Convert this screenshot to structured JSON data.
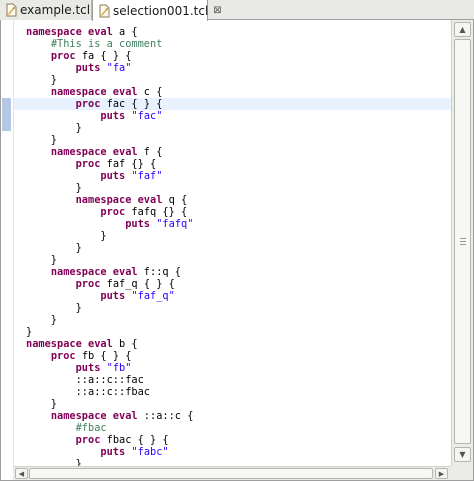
{
  "tabs": [
    {
      "label": "example.tcl",
      "active": false
    },
    {
      "label": "selection001.tcl",
      "active": true,
      "close": "⊠"
    }
  ],
  "colors": {
    "keyword": "#7f0055",
    "comment": "#3f7f5f",
    "string": "#2a00ff",
    "current_line": "#e8f2fe"
  },
  "icons": {
    "file": "tcl-file-icon",
    "close": "close-icon"
  },
  "editor": {
    "current_line": 6,
    "lines": [
      [
        [
          "kw",
          "namespace eval"
        ],
        [
          "t",
          " a {"
        ]
      ],
      [
        [
          "t",
          "    "
        ],
        [
          "cm",
          "#This is a comment"
        ]
      ],
      [
        [
          "t",
          "    "
        ],
        [
          "kw",
          "proc"
        ],
        [
          "t",
          " fa { } {"
        ]
      ],
      [
        [
          "t",
          "        "
        ],
        [
          "kw",
          "puts"
        ],
        [
          "t",
          " "
        ],
        [
          "st",
          "\"fa\""
        ]
      ],
      [
        [
          "t",
          "    }"
        ]
      ],
      [
        [
          "t",
          "    "
        ],
        [
          "kw",
          "namespace eval"
        ],
        [
          "t",
          " c {"
        ]
      ],
      [
        [
          "t",
          "        "
        ],
        [
          "kw",
          "proc"
        ],
        [
          "t",
          " fac { } {"
        ]
      ],
      [
        [
          "t",
          "            "
        ],
        [
          "kw",
          "puts"
        ],
        [
          "t",
          " "
        ],
        [
          "st",
          "\"fac\""
        ]
      ],
      [
        [
          "t",
          "        }"
        ]
      ],
      [
        [
          "t",
          "    }"
        ]
      ],
      [
        [
          "t",
          "    "
        ],
        [
          "kw",
          "namespace eval"
        ],
        [
          "t",
          " f {"
        ]
      ],
      [
        [
          "t",
          "        "
        ],
        [
          "kw",
          "proc"
        ],
        [
          "t",
          " faf {} {"
        ]
      ],
      [
        [
          "t",
          "            "
        ],
        [
          "kw",
          "puts"
        ],
        [
          "t",
          " "
        ],
        [
          "st",
          "\"faf\""
        ]
      ],
      [
        [
          "t",
          "        }"
        ]
      ],
      [
        [
          "t",
          "        "
        ],
        [
          "kw",
          "namespace eval"
        ],
        [
          "t",
          " q {"
        ]
      ],
      [
        [
          "t",
          "            "
        ],
        [
          "kw",
          "proc"
        ],
        [
          "t",
          " fafq {} {"
        ]
      ],
      [
        [
          "t",
          "                "
        ],
        [
          "kw",
          "puts"
        ],
        [
          "t",
          " "
        ],
        [
          "st",
          "\"fafq\""
        ]
      ],
      [
        [
          "t",
          "            }"
        ]
      ],
      [
        [
          "t",
          "        }"
        ]
      ],
      [
        [
          "t",
          "    }"
        ]
      ],
      [
        [
          "t",
          "    "
        ],
        [
          "kw",
          "namespace eval"
        ],
        [
          "t",
          " f::q {"
        ]
      ],
      [
        [
          "t",
          "        "
        ],
        [
          "kw",
          "proc"
        ],
        [
          "t",
          " faf_q { } {"
        ]
      ],
      [
        [
          "t",
          "            "
        ],
        [
          "kw",
          "puts"
        ],
        [
          "t",
          " "
        ],
        [
          "st",
          "\"faf_q\""
        ]
      ],
      [
        [
          "t",
          "        }"
        ]
      ],
      [
        [
          "t",
          "    }"
        ]
      ],
      [
        [
          "t",
          "}"
        ]
      ],
      [
        [
          "kw",
          "namespace eval"
        ],
        [
          "t",
          " b {"
        ]
      ],
      [
        [
          "t",
          "    "
        ],
        [
          "kw",
          "proc"
        ],
        [
          "t",
          " fb { } {"
        ]
      ],
      [
        [
          "t",
          "        "
        ],
        [
          "kw",
          "puts"
        ],
        [
          "t",
          " "
        ],
        [
          "st",
          "\"fb\""
        ]
      ],
      [
        [
          "t",
          "        ::a::c::fac"
        ]
      ],
      [
        [
          "t",
          "        ::a::c::fbac"
        ]
      ],
      [
        [
          "t",
          "    }"
        ]
      ],
      [
        [
          "t",
          "    "
        ],
        [
          "kw",
          "namespace eval"
        ],
        [
          "t",
          " ::a::c {"
        ]
      ],
      [
        [
          "t",
          "        "
        ],
        [
          "cm",
          "#fbac"
        ]
      ],
      [
        [
          "t",
          "        "
        ],
        [
          "kw",
          "proc"
        ],
        [
          "t",
          " fbac { } {"
        ]
      ],
      [
        [
          "t",
          "            "
        ],
        [
          "kw",
          "puts"
        ],
        [
          "t",
          " "
        ],
        [
          "st",
          "\"fabc\""
        ]
      ],
      [
        [
          "t",
          "        }"
        ]
      ]
    ]
  },
  "scrollbars": {
    "vertical": {
      "up": "▲",
      "down": "▼"
    },
    "horizontal": {
      "left": "◀",
      "right": "▶"
    }
  }
}
